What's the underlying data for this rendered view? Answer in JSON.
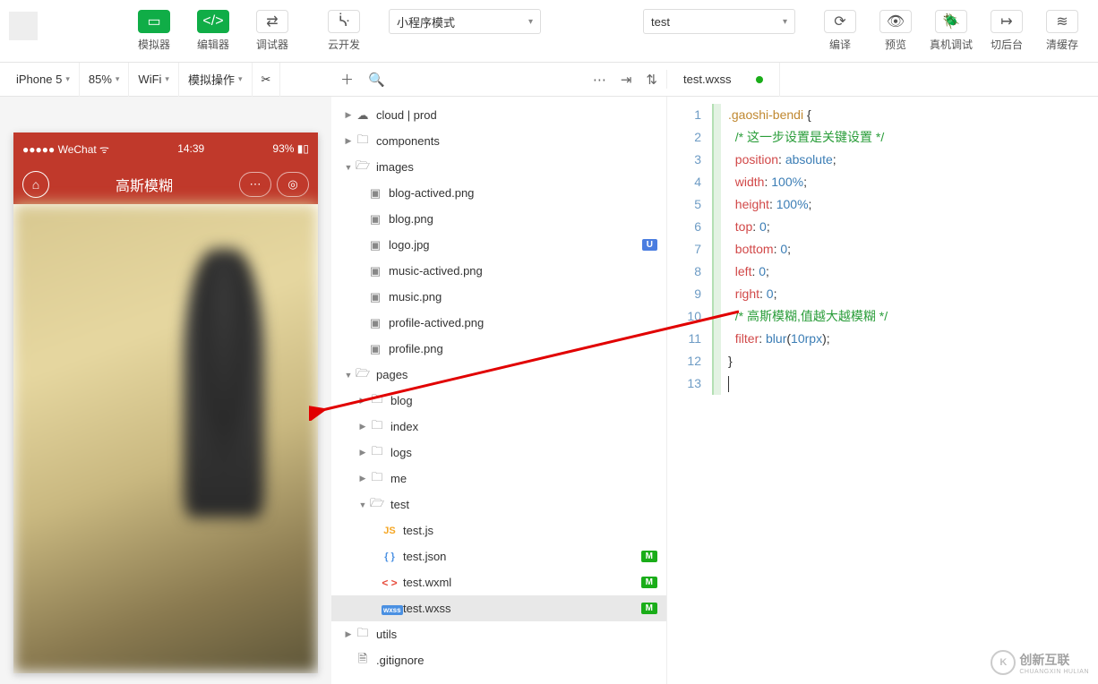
{
  "toolbar": {
    "simulator": "模拟器",
    "editor": "编辑器",
    "debugger": "调试器",
    "cloud_dev": "云开发",
    "mode_select": "小程序模式",
    "project_select": "test",
    "compile": "编译",
    "preview": "预览",
    "real_device": "真机调试",
    "background": "切后台",
    "clear_cache": "清缓存"
  },
  "subbar": {
    "device": "iPhone 5",
    "zoom": "85%",
    "network": "WiFi",
    "sim_op": "模拟操作"
  },
  "file_tab": {
    "name": "test.wxss"
  },
  "phone": {
    "carrier": "WeChat",
    "time": "14:39",
    "battery": "93%",
    "title": "高斯模糊"
  },
  "tree": {
    "cloud": "cloud | prod",
    "components": "components",
    "images": "images",
    "files_images": [
      "blog-actived.png",
      "blog.png",
      "logo.jpg",
      "music-actived.png",
      "music.png",
      "profile-actived.png",
      "profile.png"
    ],
    "pages": "pages",
    "pages_folders": [
      "blog",
      "index",
      "logs",
      "me",
      "test"
    ],
    "test_files": {
      "js": "test.js",
      "json": "test.json",
      "wxml": "test.wxml",
      "wxss": "test.wxss"
    },
    "utils": "utils",
    "gitignore": ".gitignore",
    "badge_u": "U",
    "badge_m": "M"
  },
  "code": {
    "l1_sel": ".gaoshi-bendi",
    "l1_brace": " {",
    "l2": "/* 这一步设置是关键设置 */",
    "l3_p": "position",
    "l3_v": "absolute",
    "l4_p": "width",
    "l4_v": "100%",
    "l5_p": "height",
    "l5_v": "100%",
    "l6_p": "top",
    "l6_v": "0",
    "l7_p": "bottom",
    "l7_v": "0",
    "l8_p": "left",
    "l8_v": "0",
    "l9_p": "right",
    "l9_v": "0",
    "l10": "/* 高斯模糊,值越大越模糊 */",
    "l11_p": "filter",
    "l11_f": "blur",
    "l11_v": "10rpx",
    "l12": "}"
  },
  "watermark": {
    "logo": "K",
    "text1": "创新互联",
    "text2": "CHUANGXIN HULIAN"
  }
}
